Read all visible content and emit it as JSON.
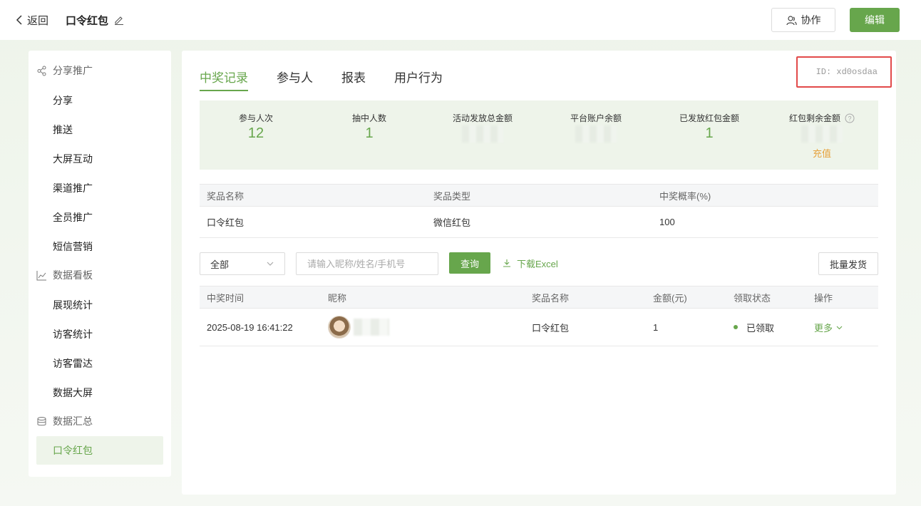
{
  "topbar": {
    "back_label": "返回",
    "title": "口令红包",
    "collab_label": "协作",
    "edit_label": "编辑"
  },
  "sidebar": {
    "groups": [
      {
        "label": "分享推广",
        "icon": "share-icon"
      },
      {
        "label": "数据看板",
        "icon": "chart-icon"
      },
      {
        "label": "数据汇总",
        "icon": "database-icon"
      }
    ],
    "items": [
      {
        "label": "分享"
      },
      {
        "label": "推送"
      },
      {
        "label": "大屏互动"
      },
      {
        "label": "渠道推广"
      },
      {
        "label": "全员推广"
      },
      {
        "label": "短信营销"
      },
      {
        "label": "展现统计"
      },
      {
        "label": "访客统计"
      },
      {
        "label": "访客雷达"
      },
      {
        "label": "数据大屏"
      },
      {
        "label": "口令红包"
      }
    ]
  },
  "tabs": [
    {
      "label": "中奖记录"
    },
    {
      "label": "参与人"
    },
    {
      "label": "报表"
    },
    {
      "label": "用户行为"
    }
  ],
  "id_text": "ID: xd0osdaa",
  "stats": {
    "participants": {
      "label": "参与人次",
      "value": "12"
    },
    "winners": {
      "label": "抽中人数",
      "value": "1"
    },
    "total_amount": {
      "label": "活动发放总金额"
    },
    "platform_balance": {
      "label": "平台账户余额"
    },
    "issued_amount": {
      "label": "已发放红包金额",
      "value": "1"
    },
    "remaining": {
      "label": "红包剩余金额",
      "recharge": "充值"
    }
  },
  "prize_table": {
    "headers": [
      "奖品名称",
      "奖品类型",
      "中奖概率(%)"
    ],
    "rows": [
      [
        "口令红包",
        "微信红包",
        "100"
      ]
    ]
  },
  "filter": {
    "select_value": "全部",
    "search_placeholder": "请输入昵称/姓名/手机号",
    "query_label": "查询",
    "download_label": "下载Excel",
    "batch_label": "批量发货"
  },
  "record_table": {
    "headers": [
      "中奖时间",
      "昵称",
      "奖品名称",
      "金额(元)",
      "领取状态",
      "操作"
    ],
    "rows": [
      {
        "time": "2025-08-19 16:41:22",
        "prize": "口令红包",
        "amount": "1",
        "status": "已领取",
        "action": "更多"
      }
    ]
  },
  "colors": {
    "accent": "#67a64c",
    "warning": "#e6a23c",
    "highlight_border": "#e24a4a"
  }
}
